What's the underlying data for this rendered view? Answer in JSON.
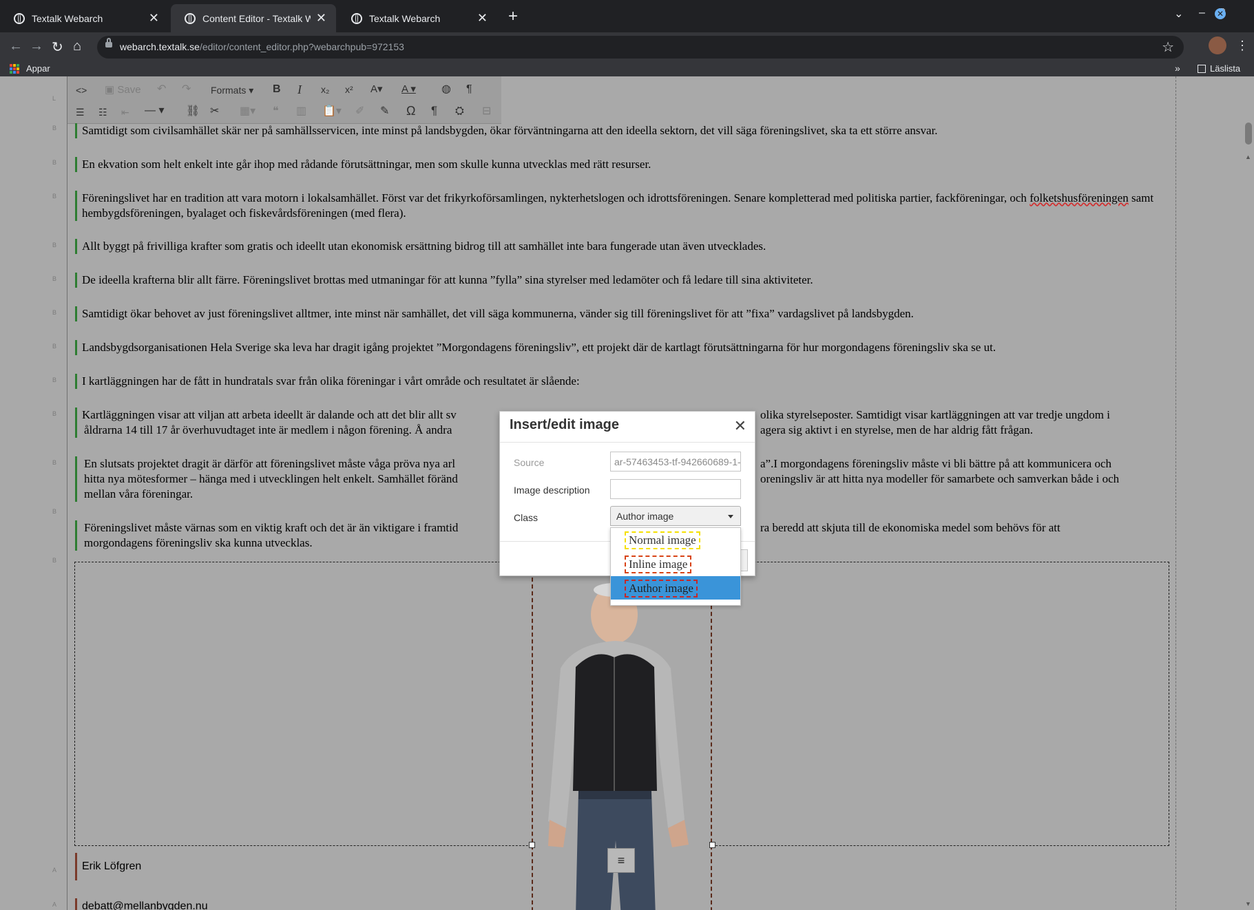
{
  "browser": {
    "tabs": [
      {
        "label": "Textalk Webarch",
        "active": false
      },
      {
        "label": "Content Editor - Textalk Weba",
        "active": true
      },
      {
        "label": "Textalk Webarch",
        "active": false
      }
    ],
    "url_domain": "webarch.textalk.se",
    "url_path": "/editor/content_editor.php?webarchpub=972153",
    "bookmarks": {
      "apps_label": "Appar",
      "reading_list_label": "Läslista"
    }
  },
  "editor_toolbar": {
    "save_label": "Save",
    "formats_label": "Formats"
  },
  "paragraphs": [
    "Samtidigt som civilsamhället skär ner på samhällsservicen, inte minst på landsbygden, ökar förväntningarna att den ideella sektorn, det vill säga föreningslivet, ska ta ett större ansvar.",
    "En ekvation som helt enkelt inte går ihop med rådande förutsättningar, men som skulle kunna utvecklas med rätt resurser.",
    "Föreningslivet har en tradition att vara motorn i lokalsamhället. Först var det frikyrkoförsamlingen, nykterhetslogen och idrottsföreningen. Senare kompletterad med politiska partier, fackföreningar, och",
    "folketshusföreningen",
    " samt hembygdsföreningen, byalaget och fiskevårdsföreningen (med flera).",
    "Allt byggt på frivilliga krafter som gratis och ideellt utan ekonomisk ersättning bidrog till att samhället inte bara fungerade utan även utvecklades.",
    "De ideella krafterna blir allt färre. Föreningslivet brottas med utmaningar för att kunna ”fylla” sina styrelser med ledamöter och få ledare till sina aktiviteter.",
    "Samtidigt ökar behovet av just föreningslivet alltmer, inte minst när samhället, det vill säga kommunerna, vänder sig till föreningslivet för att ”fixa” vardagslivet på landsbygden.",
    "Landsbygdsorganisationen Hela Sverige ska leva har dragit igång projektet ”Morgondagens föreningsliv”, ett projekt där de kartlagt förutsättningarna för hur morgondagens föreningsliv ska se ut.",
    "I kartläggningen har de fått in hundratals svar från olika föreningar i vårt område och resultatet är slående:",
    "Kartläggningen visar att viljan att arbeta ideellt är dalande och att det blir allt sv",
    "olika styrelseposter. Samtidigt visar kartläggningen att var tredje ungdom i",
    "åldrarna 14 till 17 år överhuvudtaget inte är medlem i någon förening. Å andra",
    "agera sig aktivt i en styrelse, men de har aldrig fått frågan.",
    "En slutsats projektet dragit är därför att föreningslivet måste våga pröva nya arl",
    "a”.I morgondagens föreningsliv måste vi bli bättre på att kommunicera och",
    "hitta nya mötesformer – hänga med i utvecklingen helt enkelt. Samhället föränd",
    "oreningsliv är att hitta nya modeller för samarbete och samverkan både i och",
    "mellan våra föreningar.",
    "Föreningslivet måste värnas som en viktig kraft och det är än viktigare i framtid",
    "ra beredd att skjuta till de ekonomiska medel som behövs för att",
    "morgondagens föreningsliv ska kunna utvecklas."
  ],
  "author": {
    "name": "Erik Löfgren",
    "email": "debatt@mellanbygden.nu"
  },
  "dialog": {
    "title": "Insert/edit image",
    "source_label": "Source",
    "source_value": "ar-57463453-tf-942660689-1-",
    "description_label": "Image description",
    "description_value": "",
    "class_label": "Class",
    "class_selected": "Author image",
    "class_options": [
      "Normal image",
      "Inline image",
      "Author image"
    ]
  },
  "colors": {
    "selected_option": "#3a94d9",
    "paragraph_marker": "#2e7d32",
    "author_marker": "#7a3a2a"
  }
}
